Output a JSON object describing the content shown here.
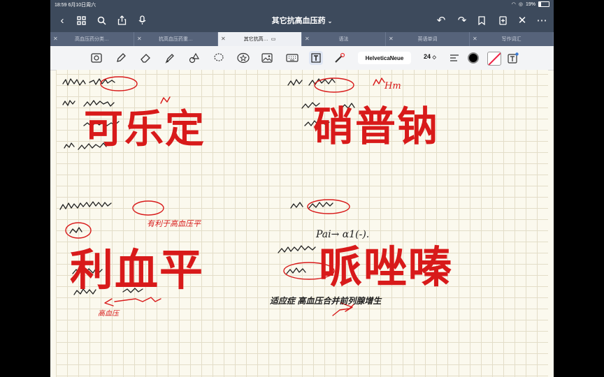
{
  "status_bar": {
    "time_date": "18:59  6月10日周六",
    "battery": "19%",
    "battery_level": 0.19
  },
  "navbar": {
    "title": "其它抗高血压药"
  },
  "tabs": [
    {
      "label": "高血压药分类…"
    },
    {
      "label": "抗高血压药重…"
    },
    {
      "label": "其它抗高…",
      "active": true
    },
    {
      "label": "语法"
    },
    {
      "label": "英语单词"
    },
    {
      "label": "写作词汇"
    }
  ],
  "toolbar": {
    "font_name": "HelveticaNeue",
    "font_size": "24",
    "text_color": "#000000"
  },
  "notes": {
    "q1_big": "可乐定",
    "q2_big": "硝普钠",
    "q3_big": "利血平",
    "q4_big": "哌唑嗪",
    "hw_en": "Hm",
    "hw_pai": "Pai→ α1(-).",
    "hw_side": "有利于高血压平",
    "hw_low": "高血压",
    "hw_bottom": "适应症 高血压合并前列腺增生"
  },
  "colors": {
    "chrome": "#3d4a5c",
    "ink_red": "#d81a1a",
    "paper": "#fbf9ee"
  }
}
